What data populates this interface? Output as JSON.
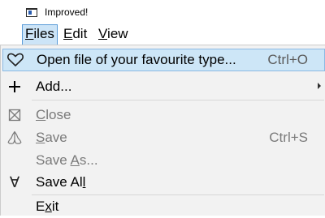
{
  "window": {
    "title": "Improved!"
  },
  "menubar": {
    "items": [
      {
        "label": "Files",
        "mnemonic": "F",
        "rest": "iles"
      },
      {
        "label": "Edit",
        "mnemonic": "E",
        "rest": "dit"
      },
      {
        "label": "View",
        "mnemonic": "V",
        "rest": "iew"
      }
    ]
  },
  "files_menu": {
    "open": {
      "label": "Open file of your favourite type...",
      "shortcut": "Ctrl+O",
      "icon": "heart-outline-icon"
    },
    "add": {
      "label": "Add...",
      "icon": "plus-icon",
      "has_submenu": true
    },
    "close": {
      "pre": "",
      "mnemonic": "C",
      "post": "lose",
      "icon": "close-box-icon",
      "enabled": false
    },
    "save": {
      "pre": "",
      "mnemonic": "S",
      "post": "ave",
      "shortcut": "Ctrl+S",
      "icon": "hands-icon",
      "enabled": false
    },
    "save_as": {
      "pre": "Save ",
      "mnemonic": "A",
      "post": "s...",
      "enabled": false
    },
    "save_all": {
      "pre": "Save Al",
      "mnemonic": "l",
      "post": "",
      "icon": "for-all-icon",
      "icon_glyph": "∀"
    },
    "exit": {
      "pre": "E",
      "mnemonic": "x",
      "post": "it"
    }
  },
  "colors": {
    "highlight_bg": "#cde6f7",
    "highlight_border": "#8bb9e3",
    "menu_bg": "#f2f2f2",
    "disabled_text": "#7a7a7a"
  }
}
